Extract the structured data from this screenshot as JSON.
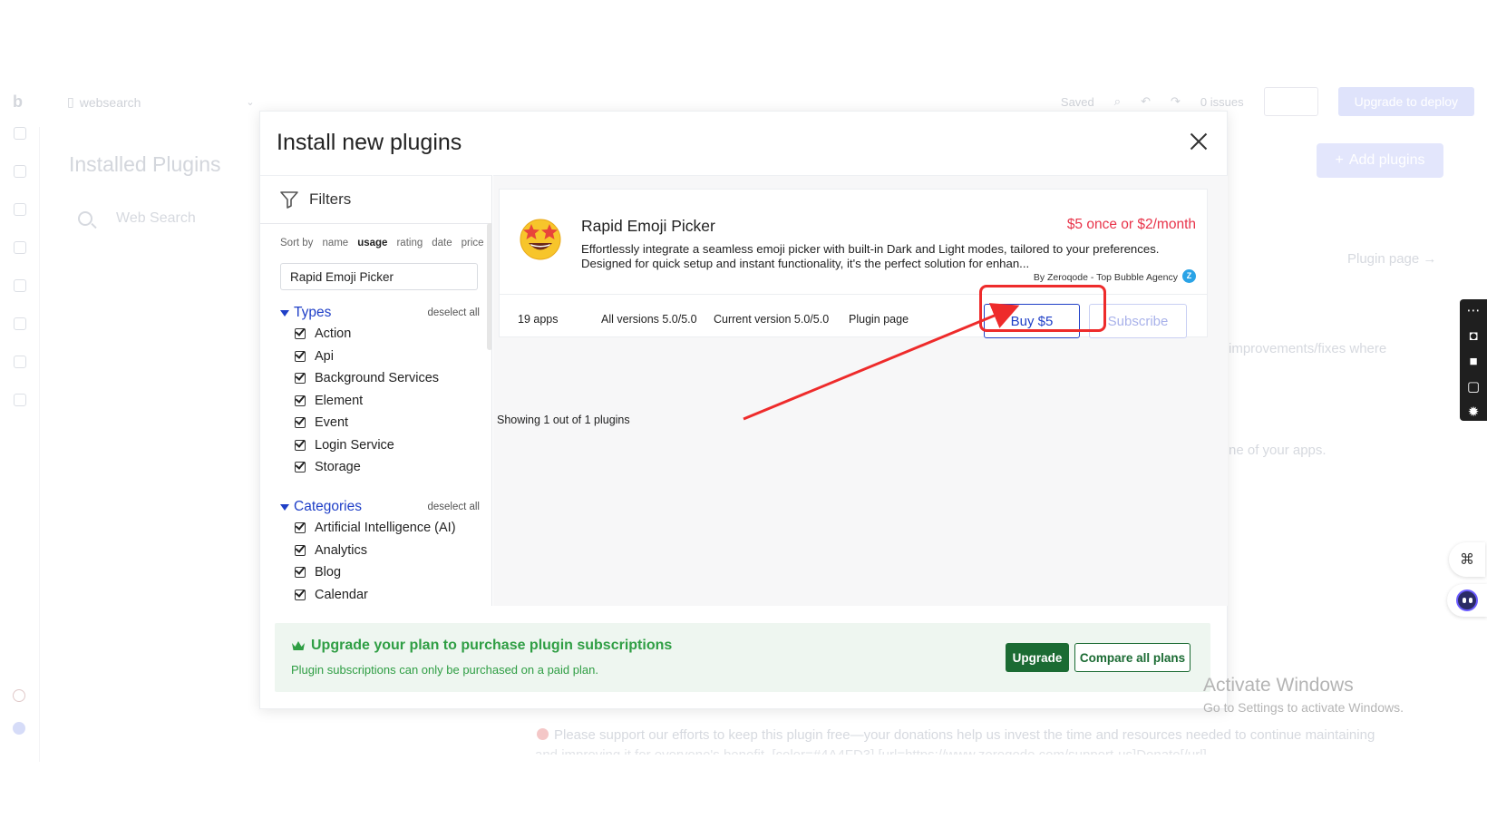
{
  "background": {
    "doc_name": "websearch",
    "saved_label": "Saved",
    "issues_label": "0 issues",
    "deploy_label": "Upgrade to deploy",
    "page_title": "Installed Plugins",
    "search_placeholder": "Web Search",
    "add_plugins_label": "Add plugins",
    "plugin_page_link": "Plugin page →",
    "faded_text_1": "improvements/fixes where",
    "faded_text_2": "ne of your apps.",
    "donation_text": "Please support our efforts to keep this plugin free—your donations help us invest the time and resources needed to continue maintaining",
    "donation_text_2": "and improving it for everyone's benefit. [color=#4A4FD3] [url=https://www.zeroqode.com/support-us]Donate[/url]"
  },
  "modal": {
    "title": "Install new plugins",
    "filters": {
      "heading": "Filters",
      "sort_label": "Sort by",
      "sort_options": [
        "name",
        "usage",
        "rating",
        "date",
        "price"
      ],
      "sort_active": "usage",
      "search_value": "Rapid Emoji Picker",
      "types": {
        "title": "Types",
        "deselect": "deselect all",
        "items": [
          "Action",
          "Api",
          "Background Services",
          "Element",
          "Event",
          "Login Service",
          "Storage"
        ]
      },
      "categories": {
        "title": "Categories",
        "deselect": "deselect all",
        "items": [
          "Artificial Intelligence (AI)",
          "Analytics",
          "Blog",
          "Calendar"
        ]
      }
    },
    "plugin": {
      "name": "Rapid Emoji Picker",
      "price": "$5 once or $2/month",
      "description": "Effortlessly integrate a seamless emoji picker with built-in Dark and Light modes, tailored to your preferences. Designed for quick setup and instant functionality, it's the perfect solution for enhan...",
      "author": "By Zeroqode - Top Bubble Agency",
      "apps": "19 apps",
      "all_versions": "All versions 5.0/5.0",
      "current_version": "Current version 5.0/5.0",
      "plugin_page": "Plugin page",
      "buy_label": "Buy $5",
      "subscribe_label": "Subscribe"
    },
    "showing": "Showing 1 out of 1 plugins",
    "upgrade": {
      "title": "Upgrade your plan to purchase plugin subscriptions",
      "subtitle": "Plugin subscriptions can only be purchased on a paid plan.",
      "upgrade_label": "Upgrade",
      "compare_label": "Compare all plans"
    }
  },
  "windows_watermark": {
    "line1": "Activate Windows",
    "line2": "Go to Settings to activate Windows."
  },
  "colors": {
    "accent_blue": "#1f3fc7",
    "price_red": "#e8344a",
    "upgrade_green": "#1b6b33",
    "annotation_red": "#ee2b2b"
  }
}
